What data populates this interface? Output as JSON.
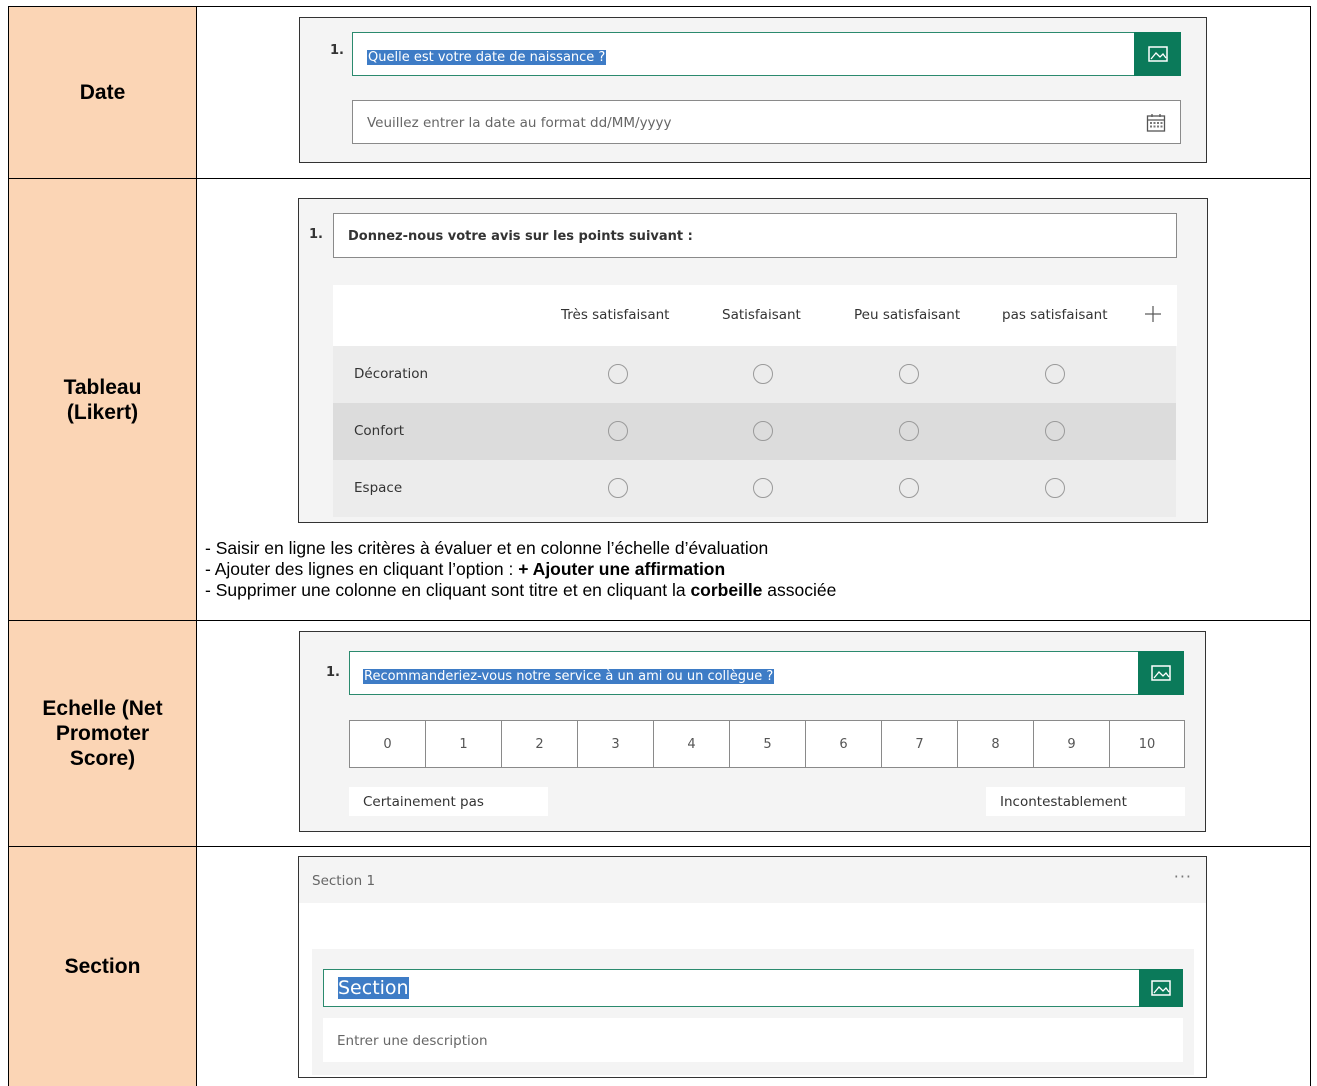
{
  "rows": [
    {
      "label": "Date"
    },
    {
      "label": "Tableau\n(Likert)"
    },
    {
      "label": "Echelle (Net\nPromoter\nScore)"
    },
    {
      "label": "Section"
    }
  ],
  "date_block": {
    "number": "1.",
    "question": "Quelle est votre date de naissance ?",
    "placeholder": "Veuillez entrer la date au format dd/MM/yyyy",
    "image_icon": "image-icon",
    "calendar_icon": "calendar-icon"
  },
  "likert_block": {
    "number": "1.",
    "question": "Donnez-nous votre avis sur les points suivant :",
    "columns": [
      "Très satisfaisant",
      "Satisfaisant",
      "Peu satisfaisant",
      "pas satisfaisant"
    ],
    "rows": [
      "Décoration",
      "Confort",
      "Espace"
    ],
    "add_icon": "plus-icon"
  },
  "notes": {
    "line1": "- Saisir en ligne les critères à évaluer et en colonne l’échelle d’évaluation",
    "line2_prefix": "- Ajouter des lignes en cliquant l’option : ",
    "line2_bold": "+ Ajouter une affirmation",
    "line3_prefix": "- Supprimer une colonne en cliquant sont titre et en cliquant la ",
    "line3_bold": "corbeille",
    "line3_suffix": " associée"
  },
  "nps_block": {
    "number": "1.",
    "question": "Recommanderiez-vous notre service à un ami ou un collègue ?",
    "scale": [
      "0",
      "1",
      "2",
      "3",
      "4",
      "5",
      "6",
      "7",
      "8",
      "9",
      "10"
    ],
    "low_label": "Certainement pas",
    "high_label": "Incontestablement"
  },
  "section_block": {
    "header": "Section 1",
    "more_icon": "ellipsis-icon",
    "title": "Section",
    "description_placeholder": "Entrer une description"
  },
  "colors": {
    "label_bg": "#fbd5b5",
    "accent_green": "#0b7a5a",
    "highlight_blue": "#3e7cc6"
  }
}
